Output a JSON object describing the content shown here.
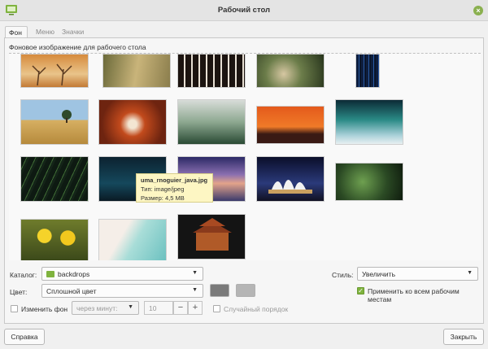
{
  "window": {
    "title": "Рабочий стол"
  },
  "tabs": [
    {
      "label": "Фон",
      "active": true
    },
    {
      "label": "Меню",
      "active": false
    },
    {
      "label": "Значки",
      "active": false
    }
  ],
  "gallery": {
    "label": "Фоновое изображение для рабочего стола"
  },
  "tooltip": {
    "filename": "uma_rnoguier_java.jpg",
    "type": "Тип: image/jpeg",
    "size": "Размер: 4,5 MB"
  },
  "controls": {
    "catalog_label": "Каталог:",
    "catalog_value": "backdrops",
    "color_label": "Цвет:",
    "color_value": "Сплошной цвет",
    "primary_color": "#7a7a7a",
    "secondary_color": "#b5b5b5",
    "style_label": "Стиль:",
    "style_value": "Увеличить",
    "apply_all_label": "Применить ко всем рабочим местам",
    "apply_all_checked": true,
    "change_bg_label": "Изменить фон",
    "change_bg_checked": false,
    "interval_placeholder": "через минут:",
    "interval_value": "10",
    "random_order_label": "Случайный порядок",
    "random_order_checked": false
  },
  "buttons": {
    "help": "Справка",
    "close": "Закрыть"
  },
  "accent_color": "#7fb33e"
}
